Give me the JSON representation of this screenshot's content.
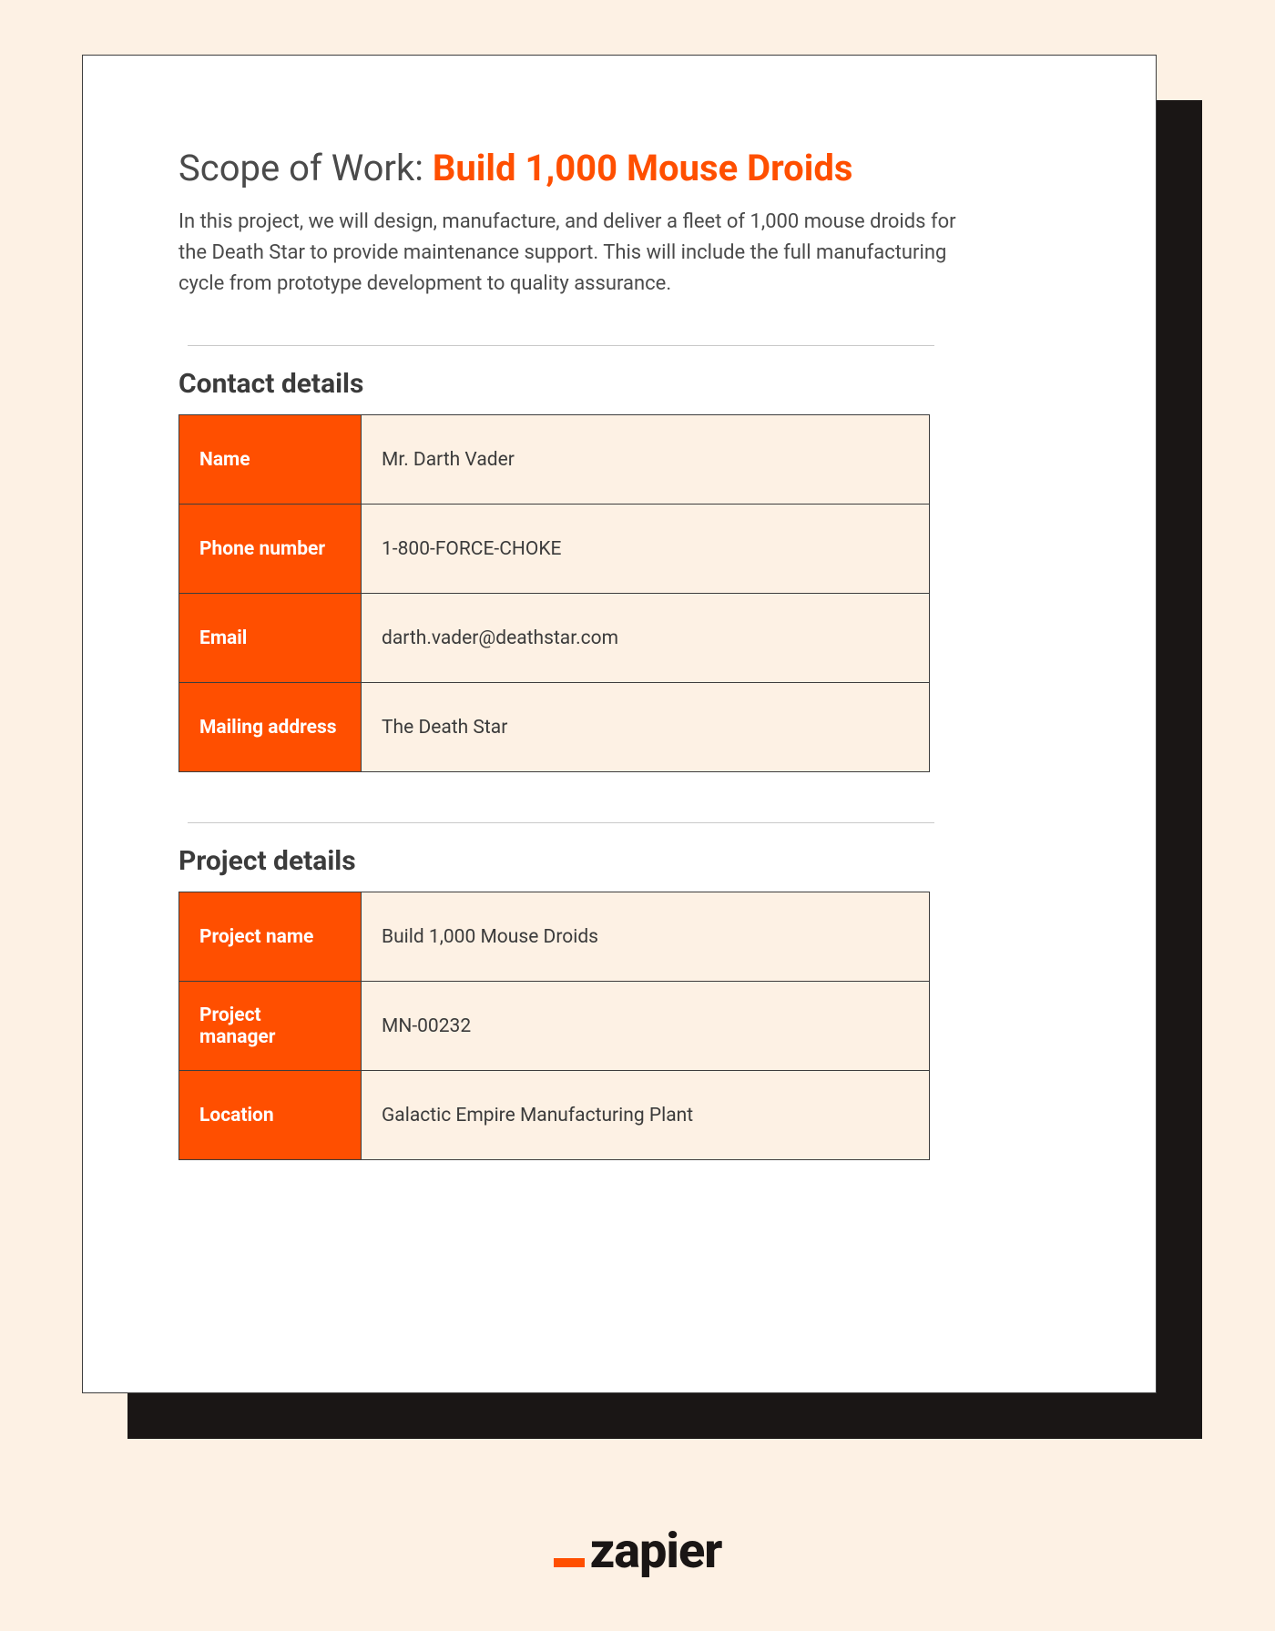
{
  "title_prefix": "Scope of Work: ",
  "title_highlight": "Build 1,000 Mouse Droids",
  "intro": "In this project, we will design, manufacture, and deliver a fleet of 1,000 mouse droids for the Death Star to provide maintenance support. This will include the full manufacturing cycle from prototype development to quality assurance.",
  "contact": {
    "heading": "Contact details",
    "rows": {
      "name_label": "Name",
      "name_value": "Mr. Darth Vader",
      "phone_label": "Phone number",
      "phone_value": "1-800-FORCE-CHOKE",
      "email_label": "Email",
      "email_value": "darth.vader@deathstar.com",
      "mailing_label": "Mailing address",
      "mailing_value": "The Death Star"
    }
  },
  "project": {
    "heading": "Project details",
    "rows": {
      "name_label": "Project name",
      "name_value": "Build 1,000 Mouse Droids",
      "manager_label": "Project manager",
      "manager_value": "MN-00232",
      "location_label": "Location",
      "location_value": "Galactic Empire Manufacturing Plant"
    }
  },
  "brand": "zapier"
}
